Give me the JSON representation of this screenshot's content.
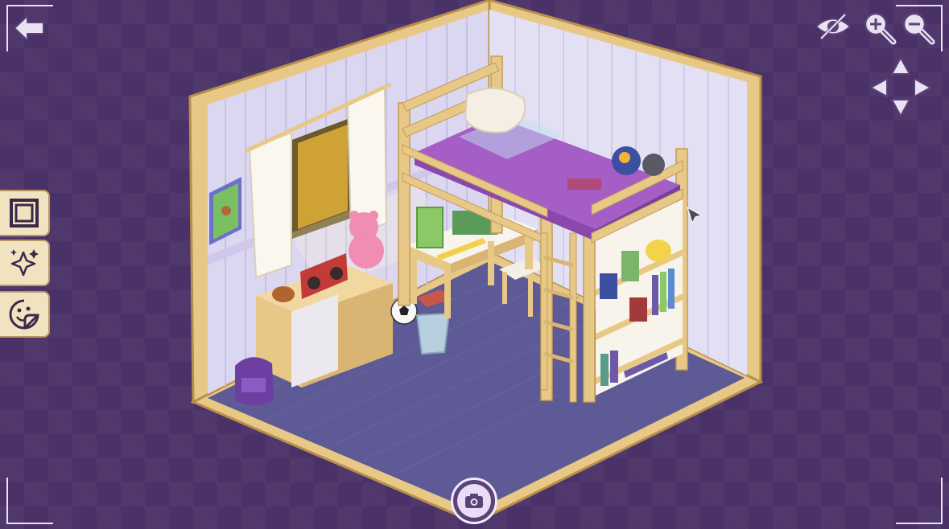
{
  "hud": {
    "back_icon": "arrow-left-icon",
    "visibility_icon": "eye-slash-icon",
    "zoom_in_icon": "magnifier-plus-icon",
    "zoom_out_icon": "magnifier-minus-icon",
    "pan_icons": [
      "triangle-up-icon",
      "triangle-left-icon",
      "triangle-right-icon",
      "triangle-down-icon"
    ],
    "camera_icon": "camera-icon"
  },
  "side_panel": {
    "items": [
      {
        "name": "frame-mode",
        "icon": "square-frame-icon"
      },
      {
        "name": "sparkle-mode",
        "icon": "sparkles-icon"
      },
      {
        "name": "sticker-mode",
        "icon": "smiley-sticker-icon"
      }
    ]
  },
  "room": {
    "objects": [
      "window-with-curtains",
      "framed-deer-picture",
      "teddy-bear",
      "boombox",
      "dresser",
      "backpack",
      "soccer-ball",
      "trash-bin",
      "desk",
      "chair",
      "loft-bed",
      "pillow",
      "plush-toys",
      "ladder",
      "bookshelf",
      "duck-toy",
      "books"
    ]
  },
  "colors": {
    "background": "#4a3168",
    "wall": "#dcd7f0",
    "floor": "#5d5a95",
    "wood": "#e8c886",
    "bedding": "#a45ec5",
    "panel": "#f2e3c0"
  }
}
